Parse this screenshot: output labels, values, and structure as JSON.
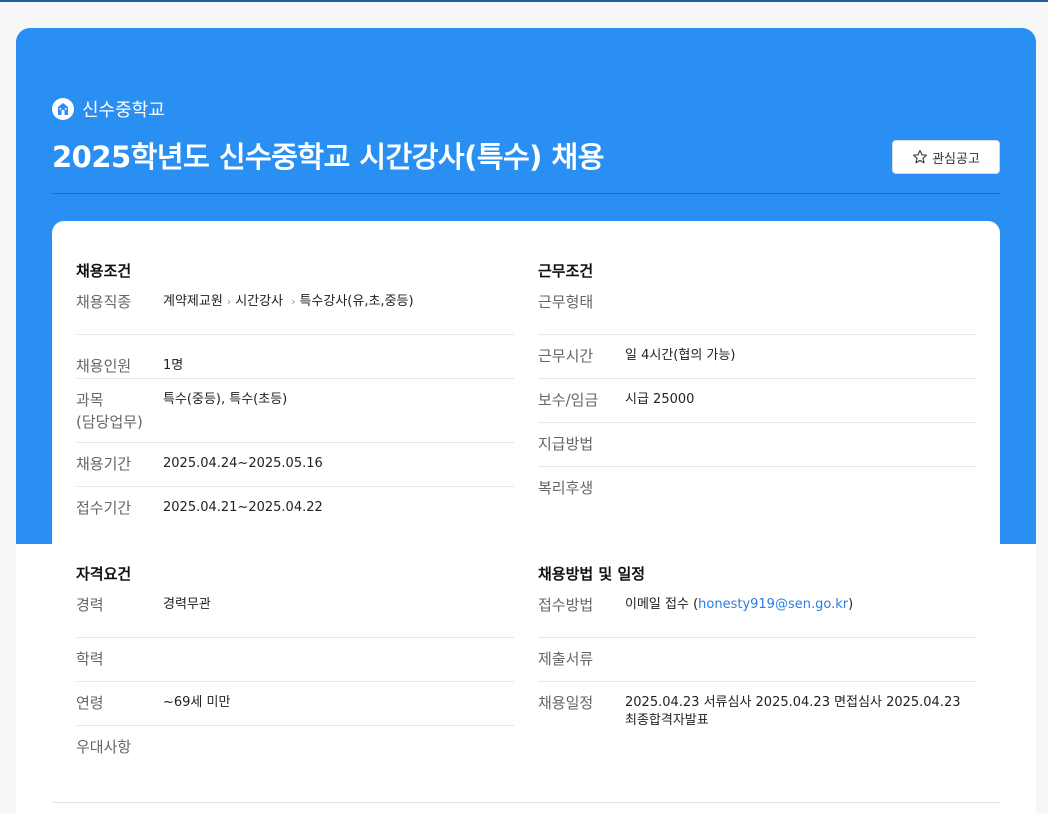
{
  "header": {
    "school_name": "신수중학교",
    "title": "2025학년도 신수중학교 시간강사(특수) 채용",
    "favorite_label": "관심공고"
  },
  "colors": {
    "hero_bg": "#2a8ff2",
    "link": "#2a7de1"
  },
  "recruit_conditions": {
    "title": "채용조건",
    "rows": [
      {
        "label": "채용직종",
        "path": [
          "계약제교원",
          "시간강사",
          "특수강사(유,초,중등)"
        ]
      },
      {
        "label": "채용인원",
        "value": "1명"
      },
      {
        "label": "과목\n(담당업무)",
        "value": "특수(중등), 특수(초등)"
      },
      {
        "label": "채용기간",
        "value": "2025.04.24~2025.05.16"
      },
      {
        "label": "접수기간",
        "value": "2025.04.21~2025.04.22"
      }
    ]
  },
  "work_conditions": {
    "title": "근무조건",
    "rows": [
      {
        "label": "근무형태",
        "value": ""
      },
      {
        "label": "근무시간",
        "value": "일 4시간(협의 가능)"
      },
      {
        "label": "보수/임금",
        "value": "시급 25000"
      },
      {
        "label": "지급방법",
        "value": ""
      },
      {
        "label": "복리후생",
        "value": ""
      }
    ]
  },
  "qualifications": {
    "title": "자격요건",
    "rows": [
      {
        "label": "경력",
        "value": "경력무관"
      },
      {
        "label": "학력",
        "value": ""
      },
      {
        "label": "연령",
        "value": "~69세 미만"
      },
      {
        "label": "우대사항",
        "value": ""
      }
    ]
  },
  "method_schedule": {
    "title": "채용방법 및 일정",
    "rows": [
      {
        "label": "접수방법",
        "value_prefix": "이메일 접수 (",
        "email": "honesty919@sen.go.kr",
        "value_suffix": ")"
      },
      {
        "label": "제출서류",
        "value": ""
      },
      {
        "label": "채용일정",
        "value": "2025.04.23 서류심사 2025.04.23 면접심사 2025.04.23 최종합격자발표"
      }
    ]
  }
}
